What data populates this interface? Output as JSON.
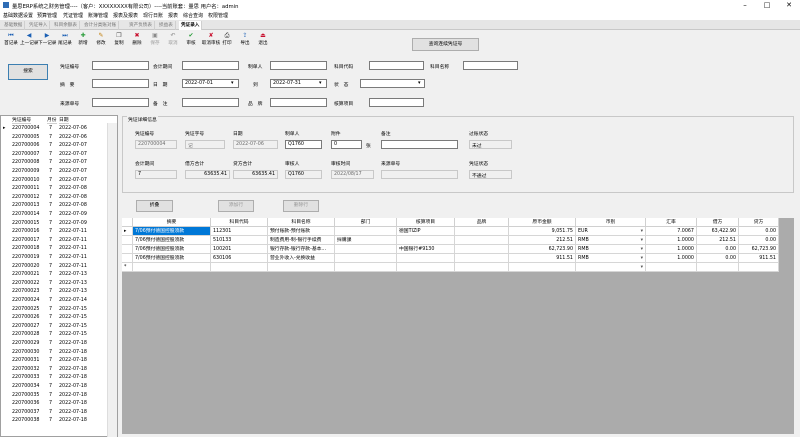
{
  "window": {
    "title": "量思ERP系统之财务管理----（客户：XXXXXXXX有限公司）----当前账套：量思 用户名：admin"
  },
  "menu": [
    "基础数据设置",
    "预算管理",
    "凭证管理",
    "账簿管理",
    "报表及报表",
    "现行日账",
    "报表",
    "综合查询",
    "权限管理"
  ],
  "tabs": [
    "基础数据",
    "凭证导入",
    "科目余额表",
    "会计分类账对账",
    "资产负债表",
    "损益表",
    "凭证录入"
  ],
  "toolbar": {
    "buttons": [
      {
        "label": "首记录",
        "icon": "first-record-icon",
        "glyph": "⏮",
        "color": "#1a5fb4",
        "disabled": false
      },
      {
        "label": "上一记录",
        "icon": "prev-record-icon",
        "glyph": "◀",
        "color": "#1a5fb4",
        "disabled": false
      },
      {
        "label": "下一记录",
        "icon": "next-record-icon",
        "glyph": "▶",
        "color": "#1a5fb4",
        "disabled": false
      },
      {
        "label": "尾记录",
        "icon": "last-record-icon",
        "glyph": "⏭",
        "color": "#1a5fb4",
        "disabled": false
      },
      {
        "label": "新增",
        "icon": "add-icon",
        "glyph": "✚",
        "color": "#2a9d3a",
        "disabled": false
      },
      {
        "label": "修改",
        "icon": "edit-icon",
        "glyph": "✎",
        "color": "#c07a00",
        "disabled": false
      },
      {
        "label": "复制",
        "icon": "copy-icon",
        "glyph": "❐",
        "color": "#444",
        "disabled": false
      },
      {
        "label": "删除",
        "icon": "delete-icon",
        "glyph": "✖",
        "color": "#c8102e",
        "disabled": false
      },
      {
        "label": "保存",
        "icon": "save-icon",
        "glyph": "▣",
        "color": "#8a8a8a",
        "disabled": true
      },
      {
        "label": "取消",
        "icon": "cancel-icon",
        "glyph": "↶",
        "color": "#8a8a8a",
        "disabled": true
      },
      {
        "label": "审核",
        "icon": "audit-icon",
        "glyph": "✔",
        "color": "#2a9d3a",
        "disabled": false
      },
      {
        "label": "取消审核",
        "icon": "unaudit-icon",
        "glyph": "✘",
        "color": "#c8102e",
        "disabled": false
      },
      {
        "label": "打印",
        "icon": "print-icon",
        "glyph": "⎙",
        "color": "#333",
        "disabled": false
      },
      {
        "label": "导出",
        "icon": "export-icon",
        "glyph": "⇪",
        "color": "#1a5fb4",
        "disabled": false
      },
      {
        "label": "退出",
        "icon": "exit-icon",
        "glyph": "⏏",
        "color": "#c8102e",
        "disabled": false
      }
    ],
    "query_button": "查询连续凭证号"
  },
  "search": {
    "button": "搜索",
    "labels": {
      "voucher_no": "凭证编号",
      "period": "会计期间",
      "maker": "制单人",
      "account_code": "科目代码",
      "account_name": "科目名称",
      "summary": "摘　要",
      "date": "日　期",
      "to": "到",
      "status": "状　态",
      "source_no": "来源单号",
      "remark": "备　注",
      "item": "品　牌",
      "settle": "核算项目"
    },
    "date_from": "2022-07-01",
    "date_to": "2022-07-31"
  },
  "left_list": {
    "headers": [
      "凭证编号",
      "月份",
      "日期"
    ],
    "rows": [
      [
        "220700004",
        "7",
        "2022-07-06"
      ],
      [
        "220700005",
        "7",
        "2022-07-06"
      ],
      [
        "220700006",
        "7",
        "2022-07-07"
      ],
      [
        "220700007",
        "7",
        "2022-07-07"
      ],
      [
        "220700008",
        "7",
        "2022-07-07"
      ],
      [
        "220700009",
        "7",
        "2022-07-07"
      ],
      [
        "220700010",
        "7",
        "2022-07-07"
      ],
      [
        "220700011",
        "7",
        "2022-07-08"
      ],
      [
        "220700012",
        "7",
        "2022-07-08"
      ],
      [
        "220700013",
        "7",
        "2022-07-08"
      ],
      [
        "220700014",
        "7",
        "2022-07-09"
      ],
      [
        "220700015",
        "7",
        "2022-07-09"
      ],
      [
        "220700016",
        "7",
        "2022-07-11"
      ],
      [
        "220700017",
        "7",
        "2022-07-11"
      ],
      [
        "220700018",
        "7",
        "2022-07-11"
      ],
      [
        "220700019",
        "7",
        "2022-07-11"
      ],
      [
        "220700020",
        "7",
        "2022-07-11"
      ],
      [
        "220700021",
        "7",
        "2022-07-13"
      ],
      [
        "220700022",
        "7",
        "2022-07-13"
      ],
      [
        "220700023",
        "7",
        "2022-07-13"
      ],
      [
        "220700024",
        "7",
        "2022-07-14"
      ],
      [
        "220700025",
        "7",
        "2022-07-15"
      ],
      [
        "220700026",
        "7",
        "2022-07-15"
      ],
      [
        "220700027",
        "7",
        "2022-07-15"
      ],
      [
        "220700028",
        "7",
        "2022-07-15"
      ],
      [
        "220700029",
        "7",
        "2022-07-18"
      ],
      [
        "220700030",
        "7",
        "2022-07-18"
      ],
      [
        "220700031",
        "7",
        "2022-07-18"
      ],
      [
        "220700032",
        "7",
        "2022-07-18"
      ],
      [
        "220700033",
        "7",
        "2022-07-18"
      ],
      [
        "220700034",
        "7",
        "2022-07-18"
      ],
      [
        "220700035",
        "7",
        "2022-07-18"
      ],
      [
        "220700036",
        "7",
        "2022-07-18"
      ],
      [
        "220700037",
        "7",
        "2022-07-18"
      ],
      [
        "220700038",
        "7",
        "2022-07-18"
      ]
    ]
  },
  "detail": {
    "title": "凭证详细信息",
    "labels": {
      "voucher_no": "凭证编号",
      "voucher_word": "凭证字号",
      "date": "日期",
      "maker": "制单人",
      "attach": "附件",
      "remark": "备注",
      "audit_state": "过账状态",
      "period": "会计期间",
      "debit_total": "借方合计",
      "credit_total": "贷方合计",
      "auditor": "审核人",
      "audit_time": "审核时间",
      "source_no": "来源单号",
      "voucher_state": "凭证状态",
      "zhang": "张"
    },
    "values": {
      "voucher_no": "220700004",
      "voucher_word": "记",
      "date": "2022-07-06",
      "maker": "Q1760",
      "attach": "0",
      "audit_state": "未过",
      "period": "7",
      "debit_total": "63635.41",
      "credit_total": "63635.41",
      "auditor": "Q1760",
      "audit_time": "2022/08/17",
      "voucher_state": "不通过"
    },
    "buttons": [
      "折叠",
      "添加行",
      "删除行"
    ]
  },
  "entries": {
    "headers": [
      "摘要",
      "科目代码",
      "科目名称",
      "部门",
      "核算项目",
      "品牌",
      "原币金额",
      "币别",
      "汇率",
      "借方",
      "贷方"
    ],
    "rows": [
      [
        "7/06预付德国控股须款",
        "112301",
        "预付账款-预付账款",
        "",
        "德国TIZIP",
        "",
        "9,051.75",
        "EUR",
        "7.0067",
        "63,422.90",
        "0.00"
      ],
      [
        "7/06预付德国控股须款",
        "510133",
        "制造费用-制-银行手续费",
        "採購課",
        "",
        "",
        "212.51",
        "RMB",
        "1.0000",
        "212.51",
        "0.00"
      ],
      [
        "7/06预付德国控股须款",
        "100201",
        "银行存款-银行存款-基本...",
        "",
        "中国银行#9130",
        "",
        "62,723.90",
        "RMB",
        "1.0000",
        "0.00",
        "62,723.90"
      ],
      [
        "7/06预付德国控股须款",
        "630106",
        "营业外收入-兑换收益",
        "",
        "",
        "",
        "911.51",
        "RMB",
        "1.0000",
        "0.00",
        "911.51"
      ]
    ]
  }
}
